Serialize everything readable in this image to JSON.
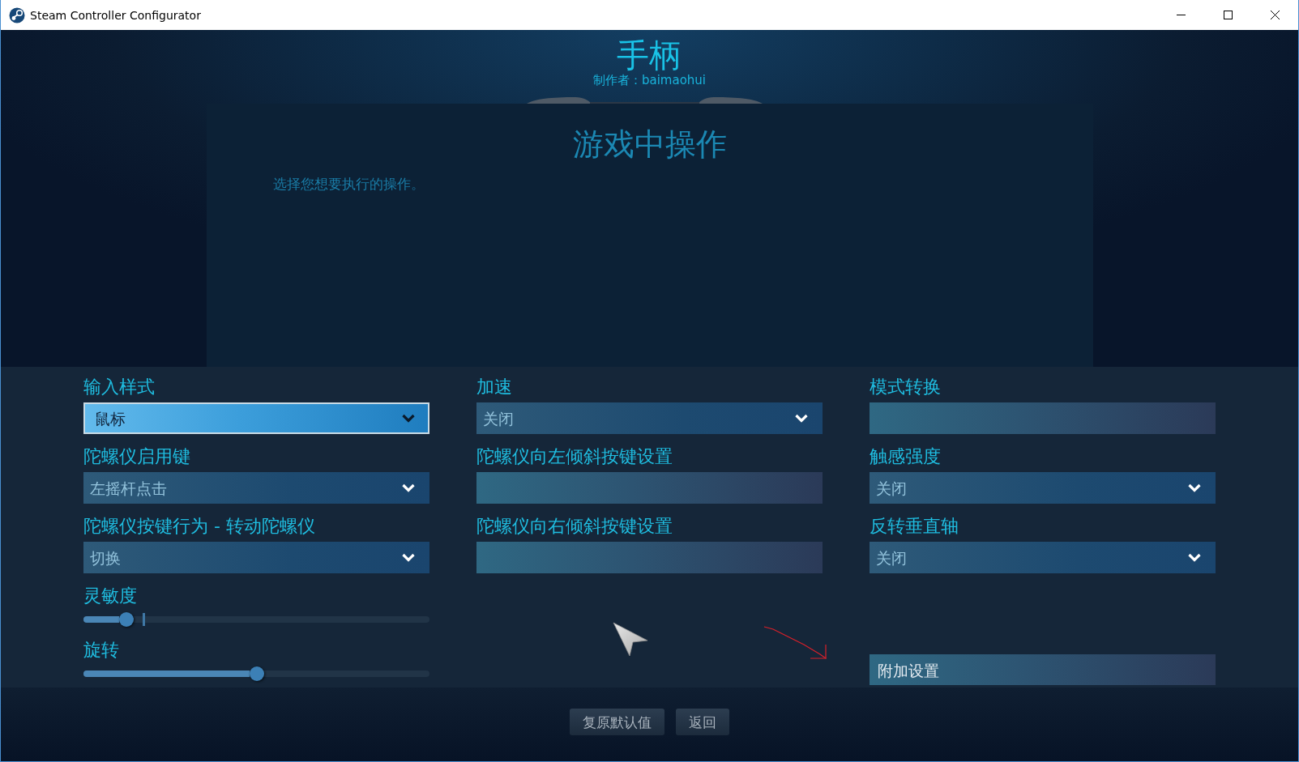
{
  "window": {
    "title": "Steam Controller Configurator"
  },
  "header": {
    "title": "手柄",
    "author": "制作者：baimaohui"
  },
  "panel": {
    "title": "游戏中操作",
    "description": "选择您想要执行的操作。"
  },
  "settings": {
    "columns": [
      {
        "items": [
          {
            "kind": "dropdown",
            "label": "输入样式",
            "value": "鼠标",
            "selected": true
          },
          {
            "kind": "dropdown",
            "label": "陀螺仪启用键",
            "value": "左摇杆点击",
            "selected": false
          },
          {
            "kind": "dropdown",
            "label": "陀螺仪按键行为 - 转动陀螺仪",
            "value": "切换",
            "selected": false
          },
          {
            "kind": "slider",
            "label": "灵敏度",
            "level": 0.125,
            "marker": true,
            "selected": false
          },
          {
            "kind": "slider",
            "label": "旋转",
            "level": 0.5,
            "marker": false,
            "selected": false
          }
        ]
      },
      {
        "items": [
          {
            "kind": "dropdown",
            "label": "加速",
            "value": "关闭",
            "selected": false
          },
          {
            "kind": "binding",
            "label": "陀螺仪向左倾斜按键设置",
            "selected": false
          },
          {
            "kind": "binding",
            "label": "陀螺仪向右倾斜按键设置",
            "selected": false
          }
        ]
      },
      {
        "items": [
          {
            "kind": "binding",
            "label": "模式转换",
            "selected": false
          },
          {
            "kind": "dropdown",
            "label": "触感强度",
            "value": "关闭",
            "selected": false
          },
          {
            "kind": "dropdown",
            "label": "反转垂直轴",
            "value": "关闭",
            "selected": false
          },
          {
            "kind": "button",
            "label": "附加设置",
            "selected": false
          }
        ]
      }
    ]
  },
  "footer": {
    "buttons": [
      "复原默认值",
      "返回"
    ]
  }
}
